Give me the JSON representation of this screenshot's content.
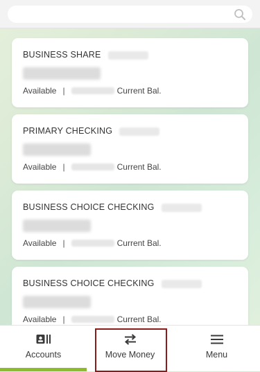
{
  "search": {
    "placeholder": ""
  },
  "accounts": [
    {
      "name": "BUSINESS SHARE",
      "available_label": "Available",
      "separator": "|",
      "current_label": "Current Bal."
    },
    {
      "name": "PRIMARY CHECKING",
      "available_label": "Available",
      "separator": "|",
      "current_label": "Current Bal."
    },
    {
      "name": "BUSINESS CHOICE CHECKING",
      "available_label": "Available",
      "separator": "|",
      "current_label": "Current Bal."
    },
    {
      "name": "BUSINESS CHOICE CHECKING",
      "available_label": "Available",
      "separator": "|",
      "current_label": "Current Bal."
    }
  ],
  "nav": {
    "accounts_label": "Accounts",
    "move_money_label": "Move Money",
    "menu_label": "Menu",
    "accounts_icon": "accounts-card-icon",
    "move_money_icon": "transfer-arrows-icon",
    "menu_icon": "hamburger-menu-icon"
  },
  "colors": {
    "accent": "#8dbb2b",
    "highlight": "#8b1a1a"
  }
}
